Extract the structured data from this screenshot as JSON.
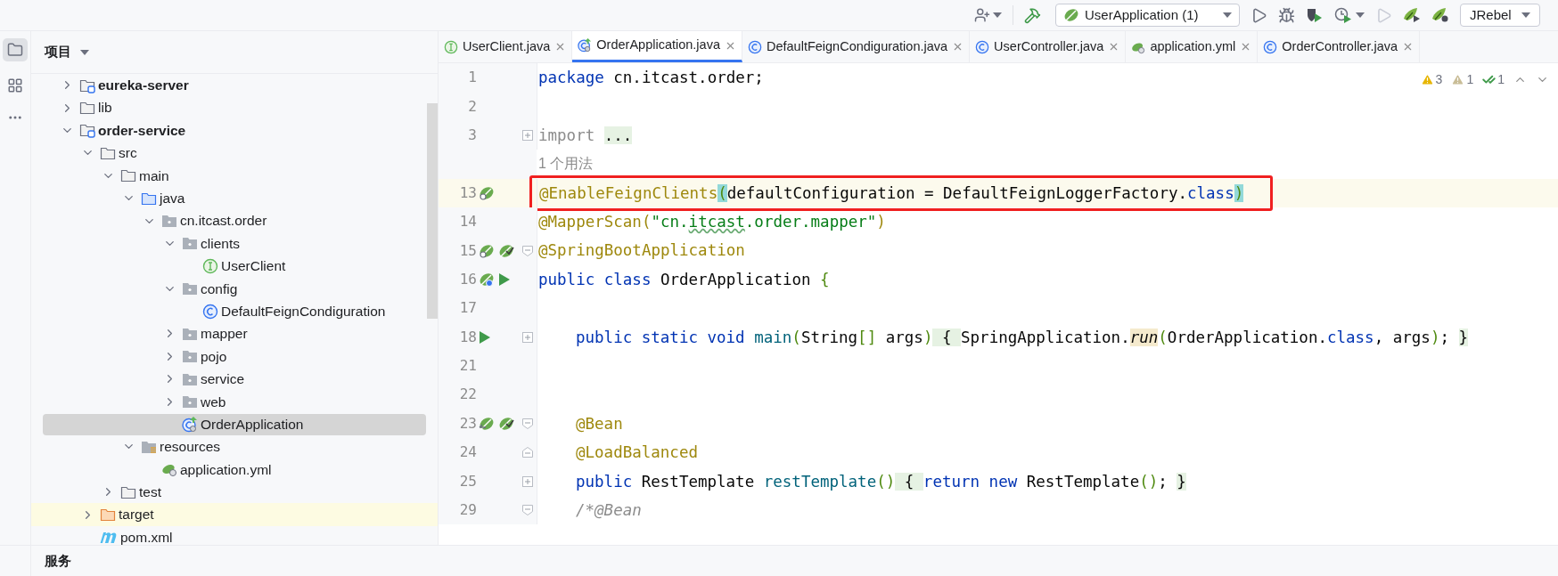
{
  "toolbar": {
    "run_config": "UserApplication (1)",
    "plugin": "JRebel"
  },
  "sidebar": {
    "title": "项目",
    "tree": [
      {
        "label": "eureka-server",
        "kind": "module",
        "expanded": false
      },
      {
        "label": "lib",
        "kind": "folder",
        "expanded": false
      },
      {
        "label": "order-service",
        "kind": "module",
        "expanded": true,
        "children": [
          {
            "label": "src",
            "kind": "folder",
            "expanded": true,
            "children": [
              {
                "label": "main",
                "kind": "folder",
                "expanded": true,
                "children": [
                  {
                    "label": "java",
                    "kind": "source-folder",
                    "expanded": true,
                    "children": [
                      {
                        "label": "cn.itcast.order",
                        "kind": "package",
                        "expanded": true,
                        "children": [
                          {
                            "label": "clients",
                            "kind": "package",
                            "expanded": true,
                            "children": [
                              {
                                "label": "UserClient",
                                "kind": "interface",
                                "selected": false
                              }
                            ]
                          },
                          {
                            "label": "config",
                            "kind": "package",
                            "expanded": true,
                            "children": [
                              {
                                "label": "DefaultFeignCondiguration",
                                "kind": "class",
                                "selected": false
                              }
                            ]
                          },
                          {
                            "label": "mapper",
                            "kind": "package",
                            "expanded": false
                          },
                          {
                            "label": "pojo",
                            "kind": "package",
                            "expanded": false
                          },
                          {
                            "label": "service",
                            "kind": "package",
                            "expanded": false
                          },
                          {
                            "label": "web",
                            "kind": "package",
                            "expanded": false
                          },
                          {
                            "label": "OrderApplication",
                            "kind": "spring-class",
                            "selected": true
                          }
                        ]
                      }
                    ]
                  },
                  {
                    "label": "resources",
                    "kind": "resources",
                    "expanded": true,
                    "children": [
                      {
                        "label": "application.yml",
                        "kind": "yml",
                        "selected": false
                      }
                    ]
                  }
                ]
              },
              {
                "label": "test",
                "kind": "folder",
                "expanded": false
              }
            ]
          },
          {
            "label": "target",
            "kind": "excluded-folder",
            "expanded": false
          },
          {
            "label": "pom.xml",
            "kind": "maven",
            "selected": false
          }
        ]
      }
    ]
  },
  "tabs": [
    {
      "label": "UserClient.java",
      "kind": "interface",
      "selected": false
    },
    {
      "label": "OrderApplication.java",
      "kind": "spring-class",
      "selected": true
    },
    {
      "label": "DefaultFeignCondiguration.java",
      "kind": "class",
      "selected": false
    },
    {
      "label": "UserController.java",
      "kind": "class",
      "selected": false
    },
    {
      "label": "application.yml",
      "kind": "yml",
      "selected": false
    },
    {
      "label": "OrderController.java",
      "kind": "class",
      "selected": false
    }
  ],
  "editor": {
    "inspections": [
      {
        "kind": "warning",
        "count": "3"
      },
      {
        "kind": "weak-warning",
        "count": "1"
      },
      {
        "kind": "typo",
        "count": "1"
      }
    ],
    "lines": [
      {
        "kind": "code",
        "number": "1",
        "tokens": [
          {
            "kind": "kw",
            "text": "package "
          },
          {
            "kind": "plain",
            "text": "cn.itcast.order;"
          }
        ]
      },
      {
        "kind": "code",
        "number": "2"
      },
      {
        "kind": "code",
        "number": "3",
        "fold": {
          "kind": "expand"
        },
        "tokens": [
          {
            "kind": "dim",
            "text": "import "
          },
          {
            "kind": "fold",
            "text": "..."
          }
        ]
      },
      {
        "kind": "hint",
        "text": "1 个用法"
      },
      {
        "kind": "code",
        "number": "13",
        "current": true,
        "boxed": true,
        "icons": [
          {
            "kind": "bean-search"
          }
        ],
        "tokens": [
          {
            "kind": "ann",
            "text": "@EnableFeignClients"
          },
          {
            "kind": "match",
            "text": "("
          },
          {
            "kind": "plain",
            "text": "defaultConfiguration = DefaultFeignLoggerFactory."
          },
          {
            "kind": "kw",
            "text": "class"
          },
          {
            "kind": "match",
            "text": ")"
          }
        ]
      },
      {
        "kind": "code",
        "number": "14",
        "tokens": [
          {
            "kind": "ann",
            "text": "@MapperScan("
          },
          {
            "kind": "str",
            "text": "\"cn."
          },
          {
            "kind": "typo",
            "text": "itcast"
          },
          {
            "kind": "str",
            "text": ".order.mapper\""
          },
          {
            "kind": "ann",
            "text": ")"
          }
        ]
      },
      {
        "kind": "code",
        "number": "15",
        "fold": {
          "kind": "collapse"
        },
        "icons": [
          {
            "kind": "bean-search"
          },
          {
            "kind": "bean-check"
          }
        ],
        "tokens": [
          {
            "kind": "ann",
            "text": "@SpringBootApplication"
          }
        ]
      },
      {
        "kind": "code",
        "number": "16",
        "icons": [
          {
            "kind": "bean-nav"
          },
          {
            "kind": "run"
          }
        ],
        "tokens": [
          {
            "kind": "kw",
            "text": "public class "
          },
          {
            "kind": "plain",
            "text": "OrderApplication "
          },
          {
            "kind": "bracket",
            "text": "{"
          }
        ]
      },
      {
        "kind": "code",
        "number": "17"
      },
      {
        "kind": "code",
        "number": "18",
        "indented": true,
        "fold": {
          "kind": "expand"
        },
        "icons": [
          {
            "kind": "run"
          }
        ],
        "tokens": [
          {
            "kind": "kw",
            "text": "public static void "
          },
          {
            "kind": "method",
            "text": "main"
          },
          {
            "kind": "bracket",
            "text": "("
          },
          {
            "kind": "plain",
            "text": "String"
          },
          {
            "kind": "bracket",
            "text": "[]"
          },
          {
            "kind": "plain",
            "text": " args"
          },
          {
            "kind": "bracket",
            "text": ")"
          },
          {
            "kind": "fold",
            "text": " { "
          },
          {
            "kind": "plain",
            "text": "SpringApplication."
          },
          {
            "kind": "call",
            "text": "run"
          },
          {
            "kind": "bracket",
            "text": "("
          },
          {
            "kind": "plain",
            "text": "OrderApplication."
          },
          {
            "kind": "kw",
            "text": "class"
          },
          {
            "kind": "plain",
            "text": ", args"
          },
          {
            "kind": "bracket",
            "text": ")"
          },
          {
            "kind": "plain",
            "text": "; "
          },
          {
            "kind": "fold",
            "text": "}"
          }
        ]
      },
      {
        "kind": "code",
        "number": "21"
      },
      {
        "kind": "code",
        "number": "22"
      },
      {
        "kind": "code",
        "number": "23",
        "indented": true,
        "fold": {
          "kind": "collapse"
        },
        "icons": [
          {
            "kind": "bean-back"
          },
          {
            "kind": "bean-check"
          }
        ],
        "tokens": [
          {
            "kind": "ann",
            "text": "@Bean"
          }
        ]
      },
      {
        "kind": "code",
        "number": "24",
        "indented": true,
        "fold": {
          "kind": "end"
        },
        "tokens": [
          {
            "kind": "ann",
            "text": "@LoadBalanced"
          }
        ]
      },
      {
        "kind": "code",
        "number": "25",
        "indented": true,
        "fold": {
          "kind": "expand"
        },
        "tokens": [
          {
            "kind": "kw",
            "text": "public "
          },
          {
            "kind": "plain",
            "text": "RestTemplate "
          },
          {
            "kind": "method",
            "text": "restTemplate"
          },
          {
            "kind": "bracket",
            "text": "()"
          },
          {
            "kind": "fold",
            "text": " { "
          },
          {
            "kind": "kw",
            "text": "return new "
          },
          {
            "kind": "plain",
            "text": "RestTemplate"
          },
          {
            "kind": "bracket",
            "text": "()"
          },
          {
            "kind": "plain",
            "text": "; "
          },
          {
            "kind": "fold",
            "text": "}"
          }
        ]
      },
      {
        "kind": "code",
        "number": "29",
        "indented": true,
        "fold": {
          "kind": "collapse"
        },
        "tokens": [
          {
            "kind": "comment",
            "text": "/*@Bean"
          }
        ]
      }
    ]
  },
  "bottom_bar": {
    "title": "服务"
  }
}
